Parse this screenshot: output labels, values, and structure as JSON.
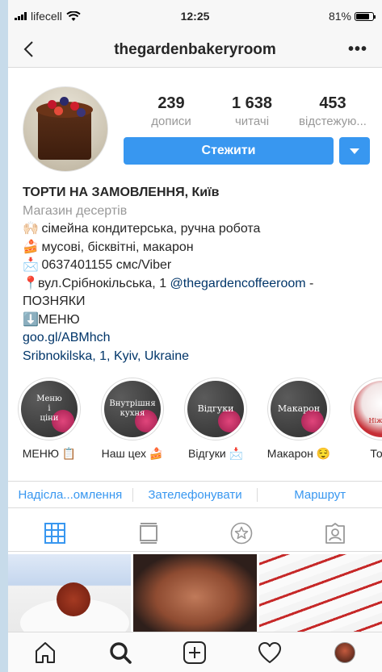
{
  "status_bar": {
    "carrier": "lifecell",
    "time": "12:25",
    "battery": "81%",
    "battery_level": 0.81
  },
  "nav": {
    "title": "thegardenbakeryroom",
    "back_icon": "chevron-left-icon",
    "more_icon": "more-horizontal-icon"
  },
  "profile": {
    "stats": [
      {
        "value": "239",
        "label": "дописи"
      },
      {
        "value": "1 638",
        "label": "читачі"
      },
      {
        "value": "453",
        "label": "відстежую..."
      }
    ],
    "follow_label": "Стежити",
    "accent_color": "#3897f0"
  },
  "bio": {
    "name": "ТОРТИ НА ЗАМОВЛЕННЯ, Київ",
    "category": "Магазин десертів",
    "lines": [
      {
        "emoji": "🙌🏻",
        "text": " сімейна кондитерська, ручна робота"
      },
      {
        "emoji": "🍰",
        "text": " мусові, бісквітні, макарон"
      },
      {
        "emoji": "📩",
        "text": " 0637401155 смс/Viber"
      }
    ],
    "address_emoji": "📍",
    "address_text": "вул.Срібнокільська, 1 ",
    "address_mention": "@thegardencoffeeroom",
    "address_tail": " -",
    "address_line2": "ПОЗНЯКИ",
    "menu_emoji": "⬇️",
    "menu_text": "МЕНЮ",
    "website": "goo.gl/ABMhch",
    "location": "Sribnokilska, 1, Kyiv, Ukraine"
  },
  "highlights": [
    {
      "cover_text": "Меню\nі\nціни",
      "label": "МЕНЮ 📋"
    },
    {
      "cover_text": "Внутрішня\nкухня",
      "label": "Наш цех 🍰"
    },
    {
      "cover_text": "Відгуки",
      "label": "Відгуки 📩"
    },
    {
      "cover_text": "Макарон",
      "label": "Макарон 😌"
    },
    {
      "cover_text": "Ніжний",
      "label": "Торт"
    }
  ],
  "actions": [
    {
      "label": "Надісла...омлення"
    },
    {
      "label": "Зателефонувати"
    },
    {
      "label": "Маршрут"
    }
  ],
  "view_tabs": [
    {
      "icon": "grid-icon",
      "active": true
    },
    {
      "icon": "feed-icon",
      "active": false
    },
    {
      "icon": "star-icon",
      "active": false
    },
    {
      "icon": "tagged-icon",
      "active": false
    }
  ],
  "tab_bar": [
    {
      "icon": "home-icon"
    },
    {
      "icon": "search-icon"
    },
    {
      "icon": "add-post-icon"
    },
    {
      "icon": "heart-icon"
    },
    {
      "icon": "profile-avatar"
    }
  ]
}
